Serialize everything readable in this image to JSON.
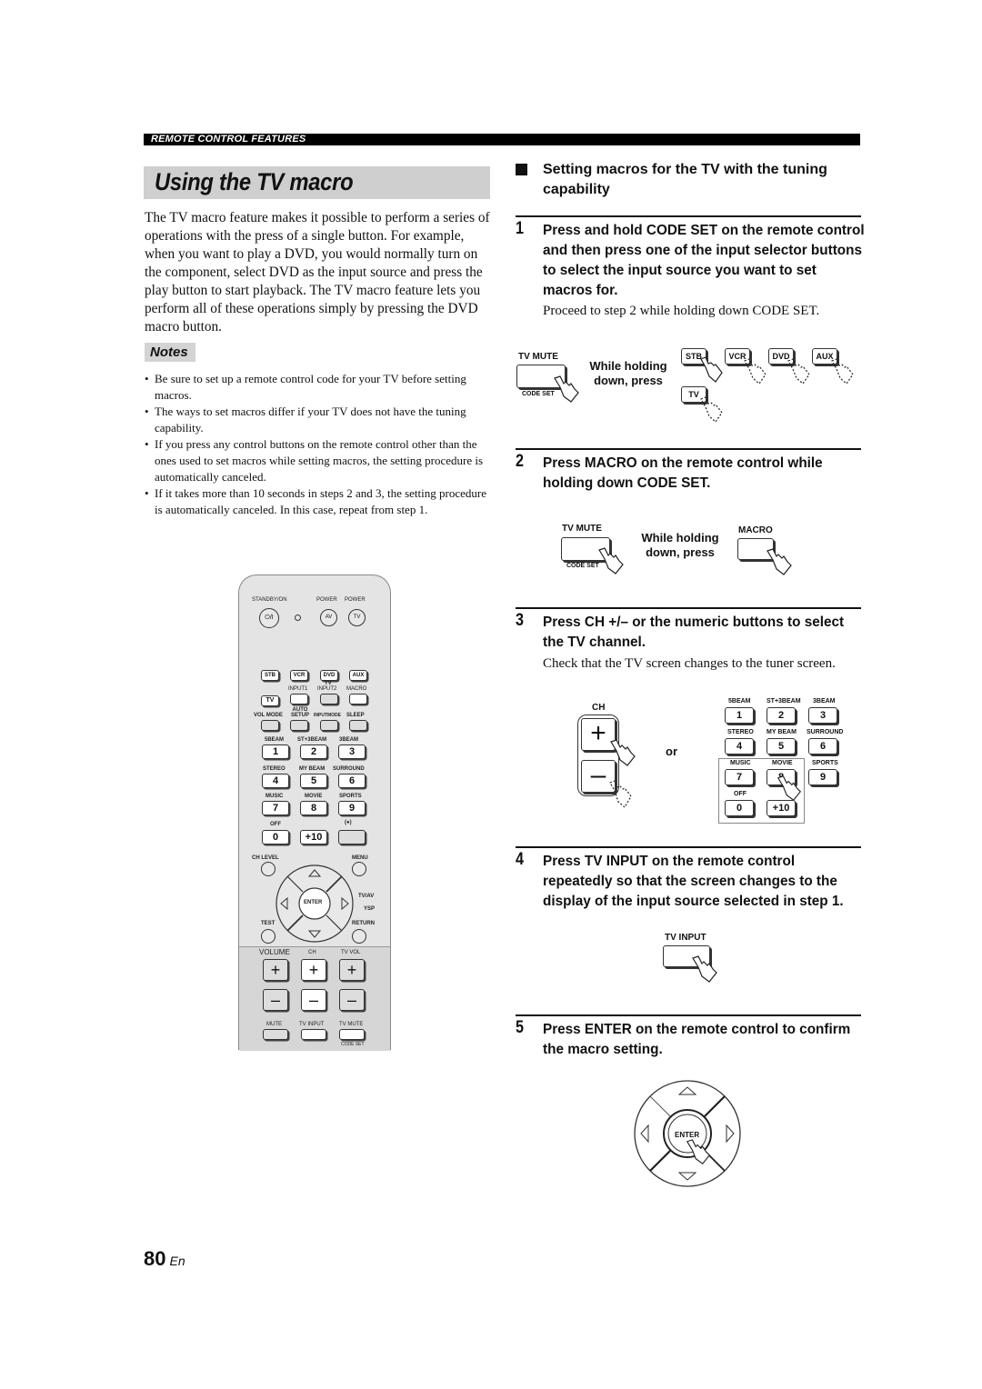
{
  "section_header": "REMOTE CONTROL FEATURES",
  "title": "Using the TV macro",
  "intro": "The TV macro feature makes it possible to perform a series of operations with the press of a single button. For example, when you want to play a DVD, you would normally turn on the component, select DVD as the input source and press the play button to start playback. The TV macro feature lets you perform all of these operations simply by pressing the DVD macro button.",
  "notes": {
    "label": "Notes",
    "items": [
      "Be sure to set up a remote control code for your TV before setting macros.",
      "The ways to set macros differ if your TV does not have the tuning capability.",
      "If you press any control buttons on the remote control other than the ones used to set macros while setting macros, the setting procedure is automatically canceled.",
      "If it takes more than 10 seconds in steps 2 and 3, the setting procedure is automatically canceled. In this case, repeat from step 1."
    ]
  },
  "remote": {
    "standby": "STANDBY/ON",
    "standby_symbol": "⏻/I",
    "power1": "POWER",
    "power2": "POWER",
    "av": "AV",
    "tv": "TV",
    "inputs": [
      "STB",
      "VCR",
      "DVD",
      "AUX"
    ],
    "tv_group": "TV",
    "input1": "INPUT1",
    "input2": "INPUT2",
    "macro": "MACRO",
    "tv_btn": "TV",
    "vol_mode": "VOL MODE",
    "auto_setup": "AUTO SETUP",
    "inputmode": "INPUTMODE",
    "sleep": "SLEEP",
    "num_labels": [
      "5BEAM",
      "ST+3BEAM",
      "3BEAM",
      "STEREO",
      "MY BEAM",
      "SURROUND",
      "MUSIC",
      "MOVIE",
      "SPORTS"
    ],
    "nums": [
      "1",
      "2",
      "3",
      "4",
      "5",
      "6",
      "7",
      "8",
      "9"
    ],
    "off": "OFF",
    "zero": "0",
    "plus10": "+10",
    "rec": "(●)",
    "ch_level": "CH LEVEL",
    "menu": "MENU",
    "enter": "ENTER",
    "tvav": "TV/AV",
    "ysp": "YSP",
    "test": "TEST",
    "return": "RETURN",
    "volume": "VOLUME",
    "ch": "CH",
    "tv_vol": "TV VOL",
    "plus": "+",
    "minus": "–",
    "mute": "MUTE",
    "tv_input": "TV INPUT",
    "tv_mute": "TV MUTE",
    "code_set": "CODE SET"
  },
  "right": {
    "heading": "Setting macros for the TV with the tuning capability",
    "steps": [
      {
        "num": "1",
        "text": "Press and hold CODE SET on the remote control and then press one of the input selector buttons to select the input source you want to set macros for.",
        "sub": "Proceed to step 2 while holding down CODE SET."
      },
      {
        "num": "2",
        "text": "Press MACRO on the remote control while holding down CODE SET.",
        "sub": ""
      },
      {
        "num": "3",
        "text": "Press CH +/– or the numeric buttons to select the TV channel.",
        "sub": "Check that the TV screen changes to the tuner screen."
      },
      {
        "num": "4",
        "text": "Press TV INPUT on the remote control repeatedly so that the screen changes to the display of the input source selected in step 1.",
        "sub": ""
      },
      {
        "num": "5",
        "text": "Press ENTER on the remote control to confirm the macro setting.",
        "sub": ""
      }
    ],
    "fig1": {
      "tv_mute": "TV MUTE",
      "code_set": "CODE SET",
      "hold": "While holding down, press",
      "buttons": [
        "STB",
        "VCR",
        "DVD",
        "AUX",
        "TV"
      ]
    },
    "fig2": {
      "tv_mute": "TV MUTE",
      "code_set": "CODE SET",
      "hold": "While holding down, press",
      "macro": "MACRO"
    },
    "fig3": {
      "ch": "CH",
      "plus": "+",
      "minus": "–",
      "or": "or",
      "labels": [
        "5BEAM",
        "ST+3BEAM",
        "3BEAM",
        "STEREO",
        "MY BEAM",
        "SURROUND",
        "MUSIC",
        "MOVIE",
        "SPORTS"
      ],
      "nums": [
        "1",
        "2",
        "3",
        "4",
        "5",
        "6",
        "7",
        "8",
        "9"
      ],
      "off": "OFF",
      "zero": "0",
      "plus10": "+10"
    },
    "fig4": {
      "tv_input": "TV INPUT"
    },
    "fig5": {
      "enter": "ENTER"
    }
  },
  "page_number": "80",
  "page_lang": "En"
}
